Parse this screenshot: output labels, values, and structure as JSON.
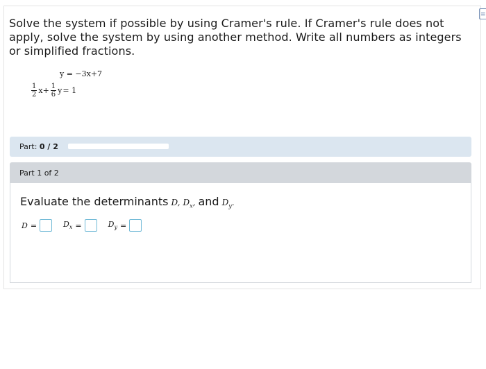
{
  "problem": {
    "text": "Solve the system if possible by using Cramer's rule. If Cramer's rule does not apply, solve the system by using another method. Write all numbers as integers or simplified fractions.",
    "eq1": "y = −3x+7",
    "eq2": {
      "frac1_num": "1",
      "frac1_den": "2",
      "var1": "x+",
      "frac2_num": "1",
      "frac2_den": "6",
      "var2": "y",
      "rhs": " = 1"
    }
  },
  "part_status": {
    "label": "Part:",
    "value": "0 / 2",
    "progress": 0
  },
  "part_header": "Part 1 of 2",
  "instruction": {
    "prefix": "Evaluate the determinants",
    "d": "D,",
    "dx_base": "D",
    "dx_sub": "x",
    "dx_comma": ",",
    "and": "and",
    "dy_base": "D",
    "dy_sub": "y",
    "dy_end": "."
  },
  "answers": {
    "d_label": "D",
    "dx_base": "D",
    "dx_sub": "x",
    "dy_base": "D",
    "dy_sub": "y",
    "equals": "="
  }
}
